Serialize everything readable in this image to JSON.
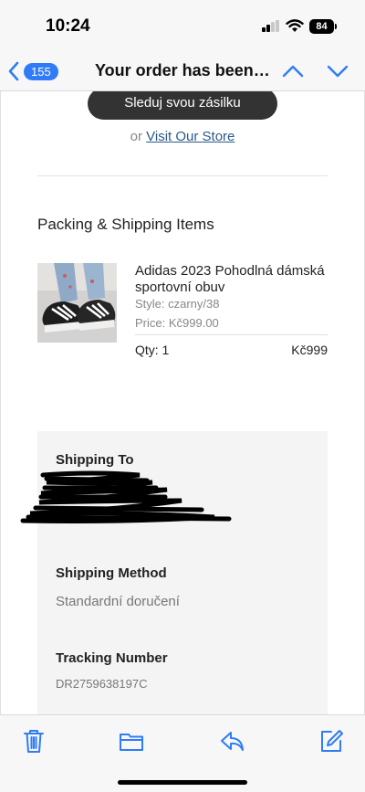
{
  "status_bar": {
    "time": "10:24",
    "battery_level": "84"
  },
  "nav": {
    "back_count": "155",
    "title": "Your order has been s..."
  },
  "email": {
    "track_button_label": "Sleduj svou zásilku",
    "or_text": "or",
    "visit_store_label": "Visit Our Store",
    "section_title": "Packing & Shipping Items",
    "product": {
      "name": "Adidas 2023 Pohodlná dámská sportovní obuv",
      "style": "Style: czarny/38",
      "price": "Price: Kč999.00",
      "qty": "Qty: 1",
      "total": "Kč999"
    },
    "shipping": {
      "to_label": "Shipping To",
      "method_label": "Shipping Method",
      "method_value": "Standardní doručení",
      "tracking_label": "Tracking Number",
      "tracking_value": "DR2759638197C"
    }
  },
  "colors": {
    "accent": "#2f7cf6",
    "button_dark": "#333333",
    "link": "#2a5a8a"
  },
  "toolbar": {
    "icons": [
      "trash-icon",
      "folder-icon",
      "reply-icon",
      "compose-icon"
    ]
  }
}
